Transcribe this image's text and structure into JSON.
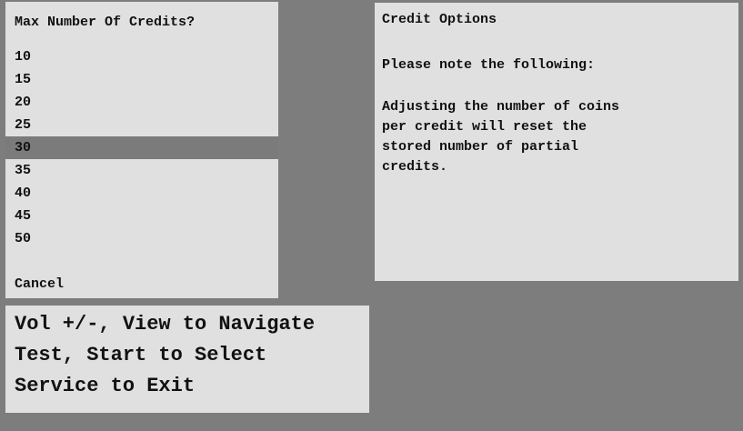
{
  "menu": {
    "title": "Max Number Of Credits?",
    "items": [
      {
        "label": "10"
      },
      {
        "label": "15"
      },
      {
        "label": "20"
      },
      {
        "label": "25"
      },
      {
        "label": "30",
        "selected": true
      },
      {
        "label": "35"
      },
      {
        "label": "40"
      },
      {
        "label": "45"
      },
      {
        "label": "50"
      }
    ],
    "cancel_label": "Cancel"
  },
  "info": {
    "title": "Credit Options",
    "note_heading": "Please note the following:",
    "body_lines": [
      "Adjusting the number of coins",
      "per credit will reset the",
      "stored number of partial",
      "credits."
    ]
  },
  "controls": {
    "lines": [
      "Vol +/-, View to Navigate",
      "Test, Start to Select",
      "Service to Exit"
    ]
  },
  "colors": {
    "background": "#7d7d7d",
    "panel": "#e0e0e0",
    "selection": "#7b7b7b",
    "text": "#111111"
  }
}
